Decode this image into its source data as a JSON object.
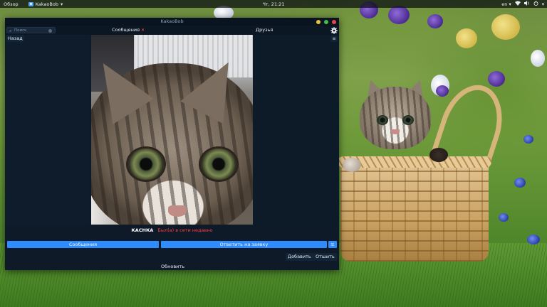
{
  "topbar": {
    "activities": "Обзор",
    "app_name": "KakaoBob",
    "clock": "Чт, 21:21",
    "lang": "en"
  },
  "window": {
    "title": "KakaoBob"
  },
  "search": {
    "placeholder": "Поиск"
  },
  "tabs": {
    "messages": "Сообщения",
    "messages_badge": "✕",
    "friends": "Друзья"
  },
  "sidebar": {
    "back": "Назад"
  },
  "profile": {
    "name": "КАСНКА",
    "status": "Был(а) в сети недавно"
  },
  "actions": {
    "messages": "Сообщения",
    "reply": "Ответить на заявку",
    "add": "Добавить",
    "cancel": "Отшить",
    "refresh": "Обновить"
  },
  "colors": {
    "window_bg": "#0e1a28",
    "accent_blue": "#2f8cff",
    "status_red": "#ff3b3b",
    "close": "#e24848",
    "minimize": "#e7c23a",
    "maximize": "#3fbf4e"
  },
  "icons": {
    "search": "search-icon",
    "gear": "gear-icon",
    "menu": "hamburger-icon",
    "power": "power-icon",
    "volume": "volume-icon",
    "network": "network-icon"
  }
}
